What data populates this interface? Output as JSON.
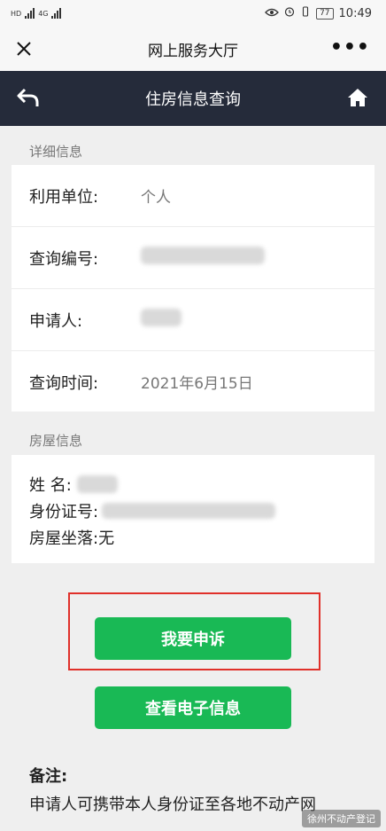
{
  "status_bar": {
    "left_label_1": "HD",
    "left_label_2": "4G",
    "left_label_3": "4G",
    "battery": "77",
    "time": "10:49"
  },
  "wechat_bar": {
    "close_icon": "close-icon",
    "title": "网上服务大厅",
    "more_icon": "more-dots-icon",
    "more_glyph": "•••"
  },
  "header": {
    "title": "住房信息查询",
    "back_icon": "back-arrow-icon",
    "home_icon": "home-icon"
  },
  "detail": {
    "label": "详细信息",
    "rows": [
      {
        "key": "利用单位:",
        "value": "个人"
      },
      {
        "key": "查询编号:",
        "value": ""
      },
      {
        "key": "申请人:",
        "value": ""
      },
      {
        "key": "查询时间:",
        "value": "2021年6月15日"
      }
    ]
  },
  "house": {
    "label": "房屋信息",
    "name_key": "姓 名:",
    "id_key": "身份证号:",
    "addr_key": "房屋坐落:",
    "addr_value": "无"
  },
  "buttons": {
    "appeal": "我要申诉",
    "view_e_info": "查看电子信息"
  },
  "note": {
    "title": "备注:",
    "line1": "申请人可携带本人身份证至各地不动产网"
  },
  "watermark": "徐州不动产登记",
  "colors": {
    "header_bg": "#252b3a",
    "button_green": "#19b955",
    "highlight_red": "#e0302a"
  }
}
